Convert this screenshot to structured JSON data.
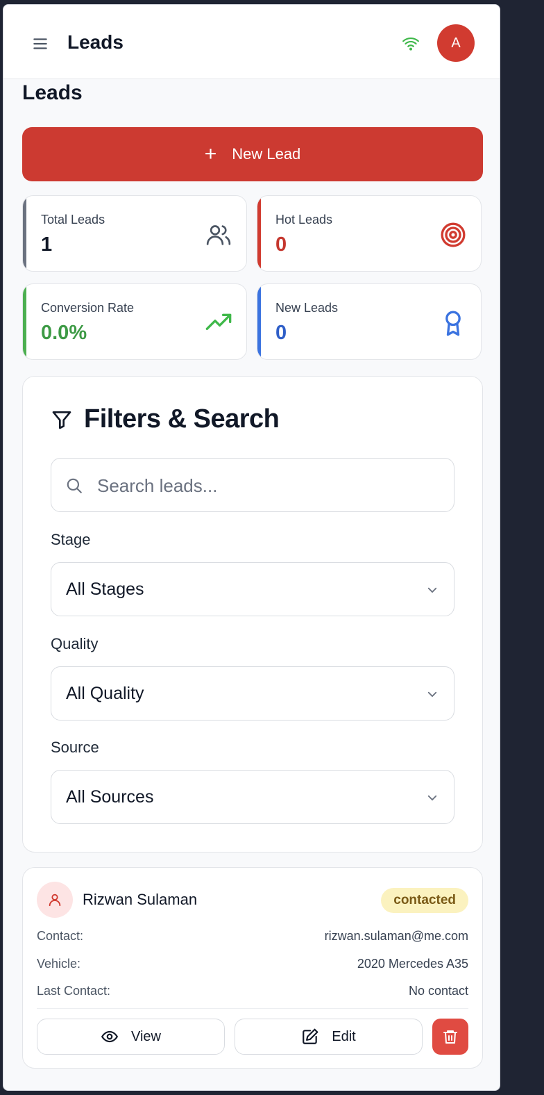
{
  "header": {
    "title": "Leads",
    "avatar_initial": "A"
  },
  "page": {
    "title": "Leads"
  },
  "new_lead_button": {
    "label": "New Lead"
  },
  "stats": [
    {
      "label": "Total Leads",
      "value": "1",
      "accent": "#6b7280",
      "value_color": "#111827",
      "icon": "users-icon"
    },
    {
      "label": "Hot Leads",
      "value": "0",
      "accent": "#d13b30",
      "value_color": "#c5372e",
      "icon": "target-icon"
    },
    {
      "label": "Conversion Rate",
      "value": "0.0%",
      "accent": "#4caf50",
      "value_color": "#3d9a45",
      "icon": "trending-up-icon"
    },
    {
      "label": "New Leads",
      "value": "0",
      "accent": "#3b73e0",
      "value_color": "#2f5fc8",
      "icon": "award-icon"
    }
  ],
  "filters": {
    "title": "Filters & Search",
    "search_placeholder": "Search leads...",
    "stage": {
      "label": "Stage",
      "value": "All Stages"
    },
    "quality": {
      "label": "Quality",
      "value": "All Quality"
    },
    "source": {
      "label": "Source",
      "value": "All Sources"
    }
  },
  "leads": [
    {
      "name": "Rizwan Sulaman",
      "status": "contacted",
      "rows": [
        {
          "key": "Contact:",
          "value": "rizwan.sulaman@me.com"
        },
        {
          "key": "Vehicle:",
          "value": "2020 Mercedes A35"
        },
        {
          "key": "Last Contact:",
          "value": "No contact"
        }
      ],
      "view_label": "View",
      "edit_label": "Edit"
    }
  ],
  "colors": {
    "primary": "#cc3a31",
    "wifi": "#3fb84a"
  }
}
